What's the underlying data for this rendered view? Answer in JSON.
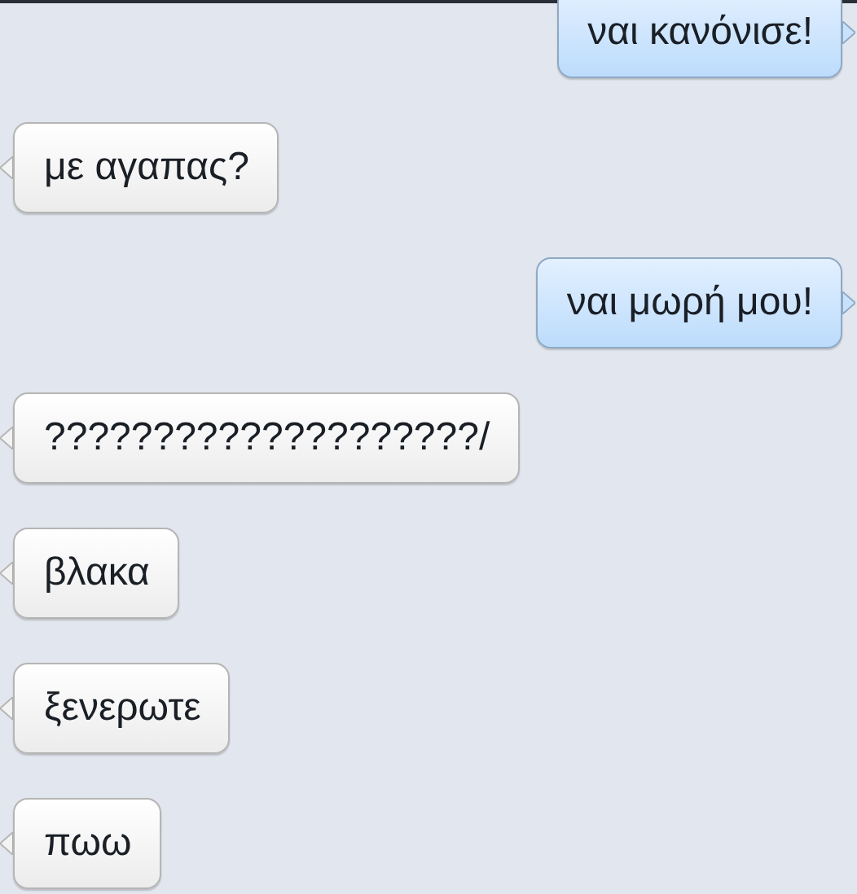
{
  "messages": [
    {
      "kind": "sent",
      "text": "ναι κανόνισε!"
    },
    {
      "kind": "received",
      "text": "με αγαπας?"
    },
    {
      "kind": "sent",
      "text": "ναι μωρή μου!"
    },
    {
      "kind": "received",
      "text": "????????????????????/"
    },
    {
      "kind": "received",
      "text": "βλακα"
    },
    {
      "kind": "received",
      "text": "ξενερωτε"
    },
    {
      "kind": "received",
      "text": "πωω"
    }
  ]
}
